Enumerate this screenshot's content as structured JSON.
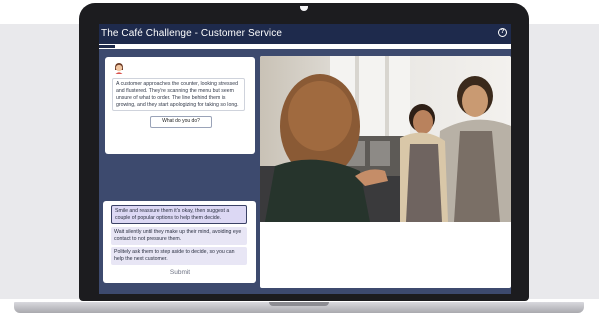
{
  "app": {
    "title": "The Café Challenge - Customer Service",
    "help_icon": "question-circle-icon",
    "progress_fraction": 0.04
  },
  "scenario": {
    "text": "A customer approaches the counter, looking stressed and flustered. They're scanning the menu but seem unsure of what to order. The line behind them is growing, and they start apologizing for taking so long.",
    "question": "What do you do?"
  },
  "options": [
    {
      "label": "Smile and reassure them it's okay, then suggest a couple of popular options to help them decide.",
      "selected": true
    },
    {
      "label": "Wait silently until they make up their mind, avoiding eye contact to not pressure them.",
      "selected": false
    },
    {
      "label": "Politely ask them to step aside to decide, so you can help the next customer.",
      "selected": false
    }
  ],
  "submit_label": "Submit",
  "colors": {
    "titlebar": "#1e2a4c",
    "sidebar": "#3d4a6e",
    "option_bg": "#e8e6f5",
    "selected_border": "#3b4266"
  }
}
